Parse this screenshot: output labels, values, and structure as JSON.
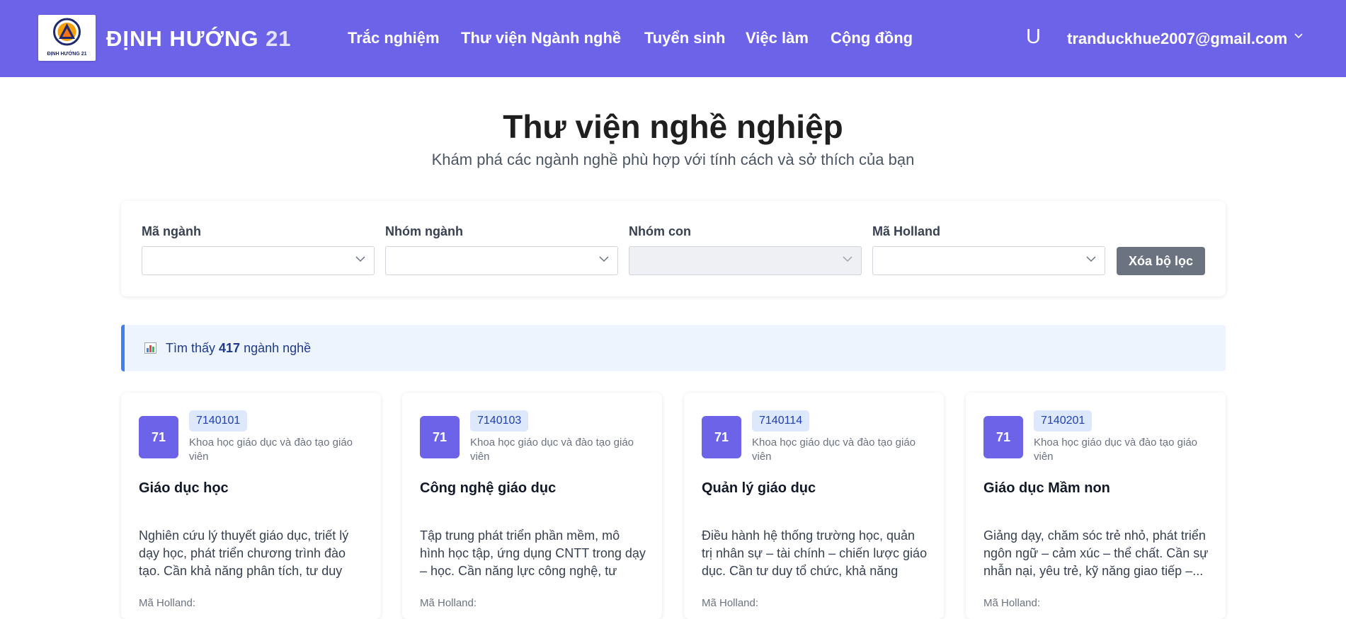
{
  "header": {
    "logo_caption": "ĐỊNH HƯỚNG 21",
    "brand_text": "ĐỊNH HƯỚNG",
    "brand_number": "21",
    "nav": [
      "Trắc nghiệm",
      "Thư viện Ngành nghề",
      "Tuyển sinh",
      "Việc làm",
      "Cộng đồng"
    ],
    "user_initial": "U",
    "user_email": "tranduckhue2007@gmail.com",
    "colors": {
      "navbar": "#6c63e9"
    }
  },
  "hero": {
    "title": "Thư viện nghề nghiệp",
    "subtitle": "Khám phá các ngành nghề phù hợp với tính cách và sở thích của bạn"
  },
  "filters": {
    "fields": [
      {
        "label": "Mã ngành",
        "value": ""
      },
      {
        "label": "Nhóm ngành",
        "value": ""
      },
      {
        "label": "Nhóm con",
        "value": ""
      },
      {
        "label": "Mã Holland",
        "value": ""
      }
    ],
    "clear_label": "Xóa bộ lọc"
  },
  "results": {
    "icon": "bar-chart-icon",
    "prefix": "Tìm thấy",
    "count": "417",
    "suffix": "ngành nghề"
  },
  "cards": [
    {
      "avatar": "71",
      "code": "7140101",
      "group": "Khoa học giáo dục và đào tạo giáo viên",
      "title": "Giáo dục học",
      "desc": "Nghiên cứu lý thuyết giáo dục, triết lý dạy học, phát triển chương trình đào tạo. Cần khả năng phân tích, tư duy hệ...",
      "holland_label": "Mã Holland:"
    },
    {
      "avatar": "71",
      "code": "7140103",
      "group": "Khoa học giáo dục và đào tạo giáo viên",
      "title": "Công nghệ giáo dục",
      "desc": "Tập trung phát triển phần mềm, mô hình học tập, ứng dụng CNTT trong dạy – học. Cần năng lực công nghệ, tư duy...",
      "holland_label": "Mã Holland:"
    },
    {
      "avatar": "71",
      "code": "7140114",
      "group": "Khoa học giáo dục và đào tạo giáo viên",
      "title": "Quản lý giáo dục",
      "desc": "Điều hành hệ thống trường học, quản trị nhân sự – tài chính – chiến lược giáo dục. Cần tư duy tổ chức, khả năng lãnh...",
      "holland_label": "Mã Holland:"
    },
    {
      "avatar": "71",
      "code": "7140201",
      "group": "Khoa học giáo dục và đào tạo giáo viên",
      "title": "Giáo dục Mầm non",
      "desc": "Giảng dạy, chăm sóc trẻ nhỏ, phát triển ngôn ngữ – cảm xúc – thể chất. Cần sự nhẫn nại, yêu trẻ, kỹ năng giao tiếp –...",
      "holland_label": "Mã Holland:"
    }
  ]
}
